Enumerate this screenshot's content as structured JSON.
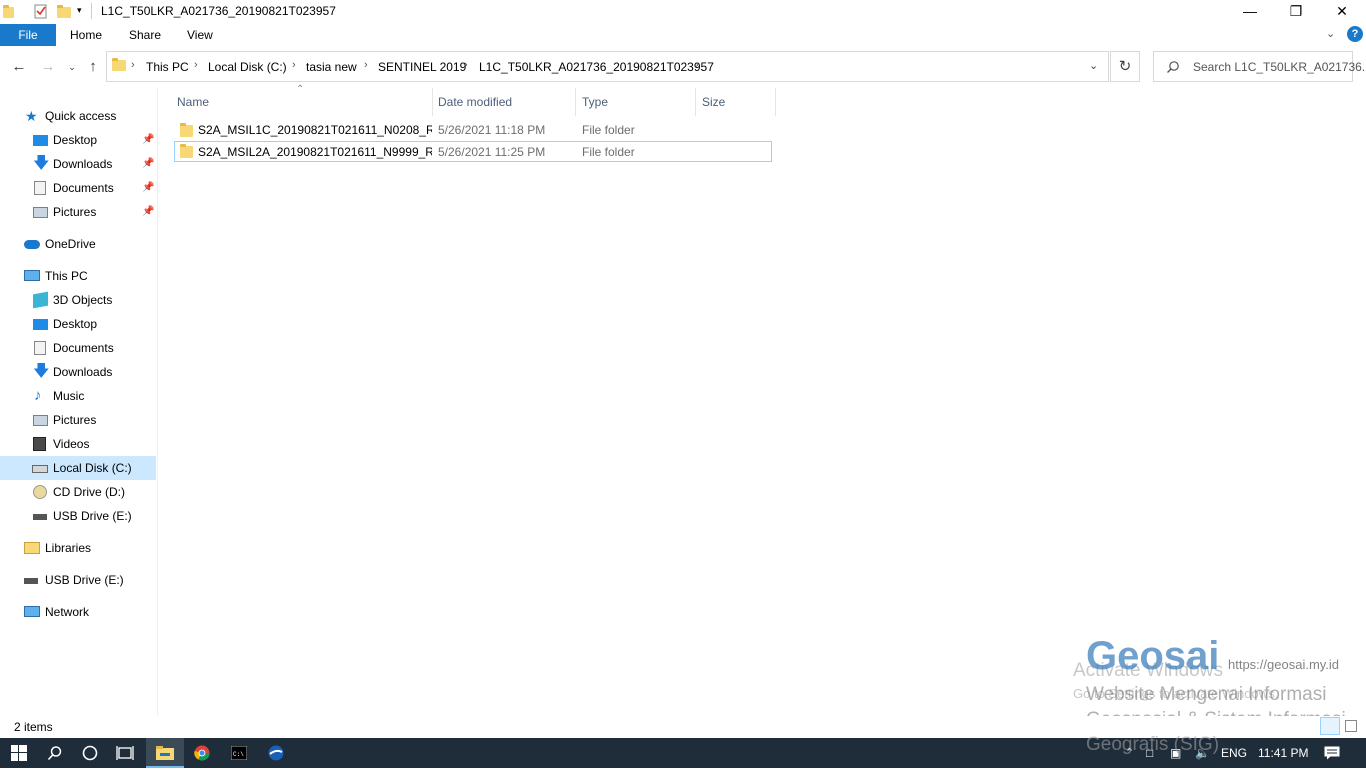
{
  "window": {
    "title": "L1C_T50LKR_A021736_20190821T023957",
    "minimize_glyph": "—",
    "maximize_glyph": "❐",
    "close_glyph": "✕"
  },
  "ribbon": {
    "tabs": [
      "File",
      "Home",
      "Share",
      "View"
    ],
    "help_glyph": "?"
  },
  "address": {
    "crumbs": [
      "This PC",
      "Local Disk (C:)",
      "tasia new",
      "SENTINEL 2019",
      "L1C_T50LKR_A021736_20190821T023957"
    ],
    "search_placeholder": "Search L1C_T50LKR_A021736..."
  },
  "nav": {
    "quick_access": "Quick access",
    "quick_items": [
      "Desktop",
      "Downloads",
      "Documents",
      "Pictures"
    ],
    "onedrive": "OneDrive",
    "this_pc": "This PC",
    "pc_items": [
      "3D Objects",
      "Desktop",
      "Documents",
      "Downloads",
      "Music",
      "Pictures",
      "Videos",
      "Local Disk (C:)",
      "CD Drive (D:)",
      "USB Drive (E:)"
    ],
    "libraries": "Libraries",
    "usb": "USB Drive (E:)",
    "network": "Network"
  },
  "columns": {
    "name": "Name",
    "date": "Date modified",
    "type": "Type",
    "size": "Size"
  },
  "files": [
    {
      "name": "S2A_MSIL1C_20190821T021611_N0208_R0...",
      "date": "5/26/2021 11:18 PM",
      "type": "File folder",
      "size": ""
    },
    {
      "name": "S2A_MSIL2A_20190821T021611_N9999_R0...",
      "date": "5/26/2021 11:25 PM",
      "type": "File folder",
      "size": ""
    }
  ],
  "status": {
    "count": "2 items"
  },
  "watermark": {
    "brand": "Geosai",
    "url": "https://geosai.my.id",
    "line1": "Website Mengenai Informasi",
    "line2": "Geospasial & Sistem Informasi",
    "line3": "Geografis (SIG)",
    "activate": "Activate Windows",
    "activate_sub": "Go to Settings to activate Windows."
  },
  "taskbar": {
    "lang": "ENG",
    "time": "11:41 PM"
  },
  "colors": {
    "accent": "#1979ca",
    "selected": "#cce8ff",
    "taskbar": "#1f2d3a",
    "folder": "#f8d775"
  }
}
